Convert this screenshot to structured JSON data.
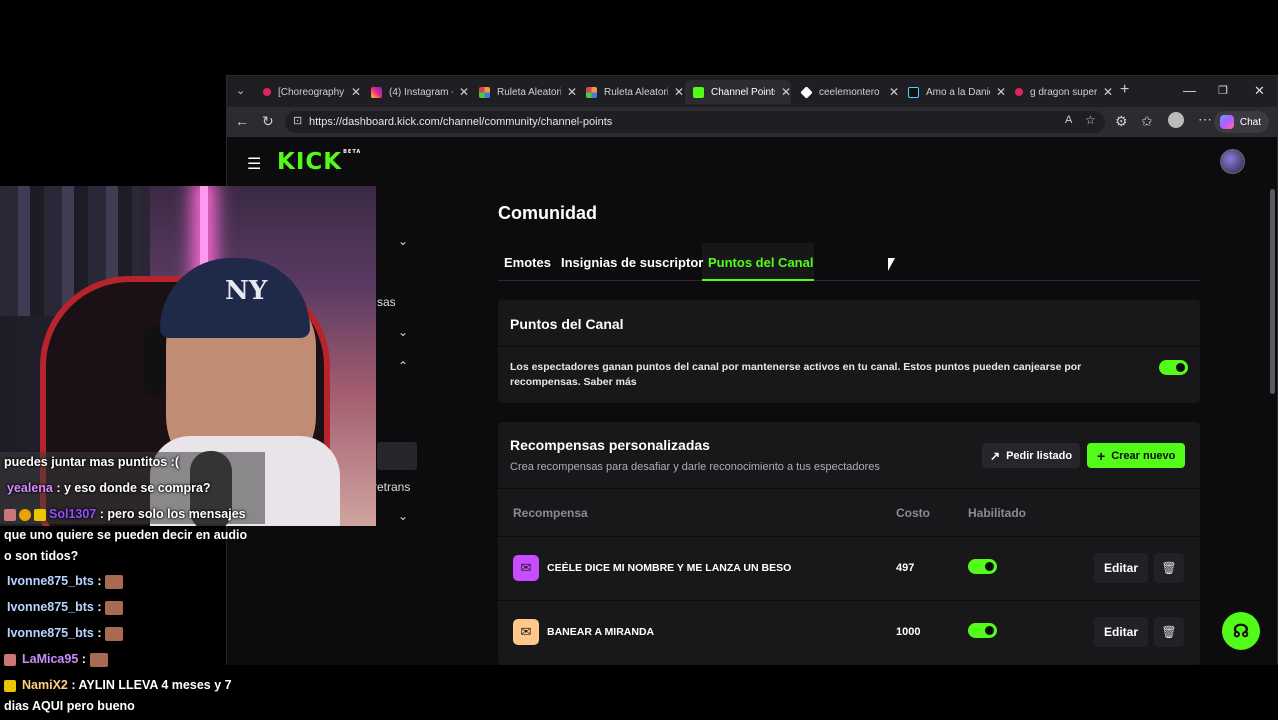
{
  "browser": {
    "tabs": [
      {
        "title": "[Choreography",
        "color": "#e0245e",
        "active": false
      },
      {
        "title": "(4) Instagram -",
        "color": "#e1306c",
        "active": false
      },
      {
        "title": "Ruleta Aleatori",
        "color": "#4b79d8",
        "active": false
      },
      {
        "title": "Ruleta Aleatori",
        "color": "#4b79d8",
        "active": false
      },
      {
        "title": "Channel Points",
        "color": "#53fc18",
        "active": true
      },
      {
        "title": "ceelemontero |",
        "color": "#ffffff",
        "active": false
      },
      {
        "title": "Amo a la Danie",
        "color": "#222222",
        "active": false
      },
      {
        "title": "g dragon super",
        "color": "#e0245e",
        "active": false
      }
    ],
    "url": "https://dashboard.kick.com/channel/community/channel-points",
    "chat_button": "Chat"
  },
  "page": {
    "logo": "KICK",
    "logo_badge": "BETA",
    "title": "Comunidad",
    "tabs": [
      "Emotes",
      "Insignias de suscriptor",
      "Puntos del Canal"
    ],
    "active_tab": "Puntos del Canal",
    "sidebar_fragments": [
      "sas",
      "retrans"
    ],
    "channel_points": {
      "heading": "Puntos del Canal",
      "description": "Los espectadores ganan puntos del canal por mantenerse activos en tu canal. Estos puntos pueden canjearse por recompensas. Saber más",
      "enabled": true
    },
    "rewards": {
      "heading": "Recompensas personalizadas",
      "subheading": "Crea recompensas para desafiar y darle reconocimiento a tus espectadores",
      "request_button": "Pedir listado",
      "create_button": "Crear nuevo",
      "columns": [
        "Recompensa",
        "Costo",
        "Habilitado"
      ],
      "rows": [
        {
          "title": "CEÉLE DICE MI NOMBRE Y ME LANZA UN BESO",
          "cost": "497",
          "enabled": true,
          "icon_color": "#c84dff",
          "edit": "Editar"
        },
        {
          "title": "BANEAR A MIRANDA",
          "cost": "1000",
          "enabled": true,
          "icon_color": "#ffc78a",
          "edit": "Editar"
        }
      ]
    }
  },
  "chat": [
    {
      "user": "",
      "text": "puedes juntar mas puntitos :(",
      "user_color": "#ffffff",
      "emote": false
    },
    {
      "user": "yealena",
      "text": " : y eso donde se compra?",
      "user_color": "#d58bff",
      "emote": false
    },
    {
      "user": "Sol1307",
      "text": " : pero solo los mensajes",
      "user_color": "#9a4dff",
      "emote": false
    },
    {
      "user": "",
      "text": "que uno quiere se pueden decir en audio",
      "user_color": "#ffffff",
      "emote": false
    },
    {
      "user": "",
      "text": "o son tidos?",
      "user_color": "#ffffff",
      "emote": false
    },
    {
      "user": "Ivonne875_bts",
      "text": " :",
      "user_color": "#b9d4ff",
      "emote": true
    },
    {
      "user": "Ivonne875_bts",
      "text": " :",
      "user_color": "#b9d4ff",
      "emote": true
    },
    {
      "user": "Ivonne875_bts",
      "text": " :",
      "user_color": "#b9d4ff",
      "emote": true
    },
    {
      "user": "LaMica95",
      "text": " :",
      "user_color": "#c98cff",
      "emote": true
    },
    {
      "user": "NamiX2",
      "text": " : AYLIN LLEVA 4 meses y 7",
      "user_color": "#ffd27a",
      "emote": false
    },
    {
      "user": "",
      "text": "dias AQUI pero bueno",
      "user_color": "#ffffff",
      "emote": false
    }
  ],
  "webcam": {
    "cap_logo": "NY"
  }
}
